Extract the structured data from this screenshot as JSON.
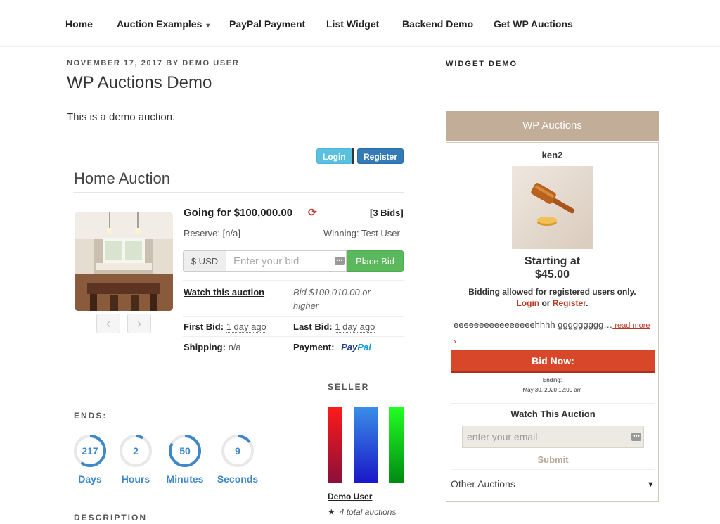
{
  "nav": {
    "items": [
      {
        "label": "Home"
      },
      {
        "label": "Auction Examples",
        "has_dropdown": true
      },
      {
        "label": "PayPal Payment"
      },
      {
        "label": "List Widget"
      },
      {
        "label": "Backend Demo"
      },
      {
        "label": "Get WP Auctions"
      }
    ],
    "dropdown_icon": "▾"
  },
  "post": {
    "meta": "November 17, 2017 by Demo User",
    "title": "WP Auctions Demo",
    "intro": "This is a demo auction."
  },
  "auth": {
    "login_label": "Login",
    "register_label": "Register"
  },
  "auction": {
    "title": "Home Auction",
    "going_for": "Going for $100,000.00",
    "refresh_icon": "⟳",
    "bids_label": "[3 Bids]",
    "reserve": "Reserve: [n/a]",
    "winning": "Winning: Test User",
    "currency_addon": "$ USD",
    "bid_placeholder": "Enter your bid",
    "place_bid_label": "Place Bid",
    "watch_label": "Watch this auction",
    "bid_min": "Bid $100,010.00 or higher",
    "first_bid_label": "First Bid:",
    "first_bid_value": "1 day ago",
    "last_bid_label": "Last Bid:",
    "last_bid_value": "1 day ago",
    "shipping_label": "Shipping:",
    "shipping_value": "n/a",
    "payment_label": "Payment:",
    "payment_logo": {
      "part1": "Pay",
      "part2": "Pal"
    },
    "prev_icon": "‹",
    "next_icon": "›"
  },
  "ends": {
    "heading": "ENDS:",
    "units": [
      {
        "value": "217",
        "label": "Days",
        "fraction": 0.6
      },
      {
        "value": "2",
        "label": "Hours",
        "fraction": 0.08
      },
      {
        "value": "50",
        "label": "Minutes",
        "fraction": 0.83
      },
      {
        "value": "9",
        "label": "Seconds",
        "fraction": 0.15
      }
    ]
  },
  "seller": {
    "heading": "SELLER",
    "name": "Demo User",
    "auctions": "4 total auctions",
    "star_icon": "★",
    "bar_colors": [
      "#e3001b",
      "#1e72d9",
      "#00c400"
    ]
  },
  "description": {
    "heading": "DESCRIPTION"
  },
  "sidebar": {
    "heading": "WIDGET DEMO",
    "widget_title": "WP Auctions",
    "user": "ken2",
    "starting_at": "Starting at $45.00",
    "allowed": "Bidding allowed for registered users only.",
    "login": "Login",
    "or": "or",
    "register": "Register",
    "period": ".",
    "excerpt": "eeeeeeeeeeeeeeeehhhh ggggggggg…",
    "read_more": " read more ›",
    "bid_now": "Bid Now:",
    "ending_label": "Ending:",
    "ending_date": "May 30, 2020 12:00 am",
    "watch_heading": "Watch This Auction",
    "email_placeholder": "enter your email",
    "submit": "Submit",
    "other_auctions": "Other Auctions",
    "other_arrow": "▼"
  },
  "colors": {
    "accent_blue": "#3f88c8",
    "bid_now_red": "#d9472b",
    "widget_tan": "#c2ad98",
    "place_bid_green": "#5cb85c"
  }
}
